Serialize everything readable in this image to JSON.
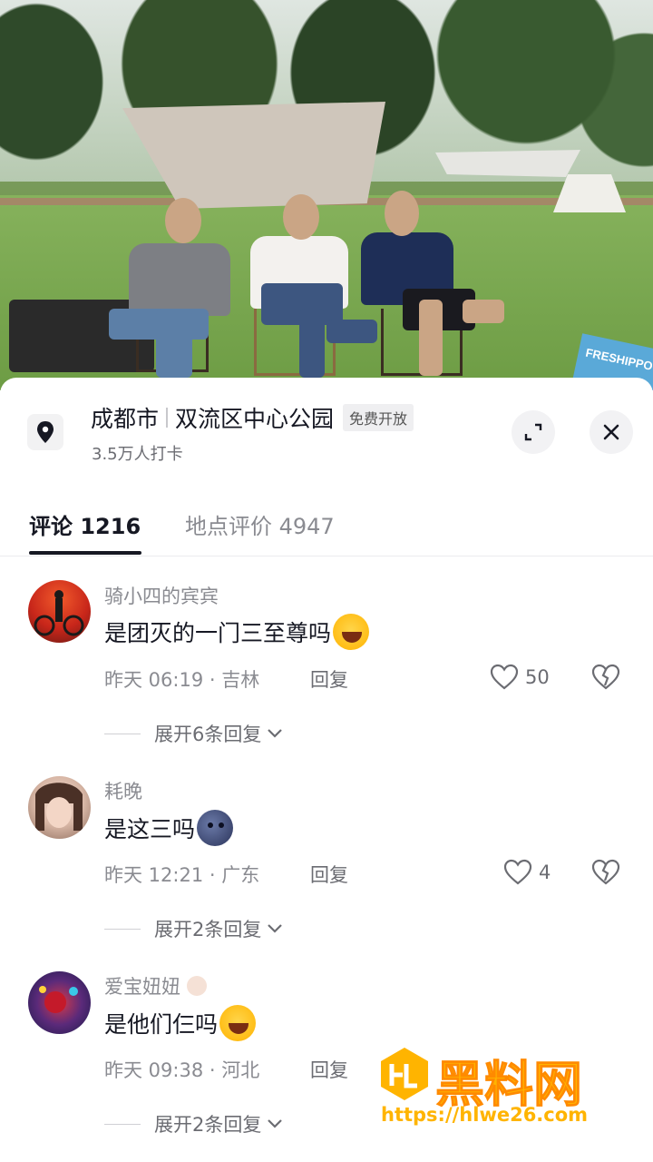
{
  "location": {
    "city": "成都市",
    "place": "双流区中心公园",
    "badge": "免费开放",
    "checkins": "3.5万人打卡"
  },
  "tabs": [
    {
      "label": "评论 1216",
      "active": true
    },
    {
      "label": "地点评价 4947",
      "active": false
    }
  ],
  "comments": [
    {
      "user": "骑小四的宾宾",
      "text": "是团灭的一门三至尊吗",
      "emoji": "grinning-squinting-face-tears",
      "time": "昨天 06:19",
      "region": "吉林",
      "reply": "回复",
      "likes": "50",
      "expand": "展开6条回复"
    },
    {
      "user": "耗晚",
      "text": "是这三吗",
      "emoji": "new-moon-face",
      "time": "昨天 12:21",
      "region": "广东",
      "reply": "回复",
      "likes": "4",
      "expand": "展开2条回复"
    },
    {
      "user": "爱宝妞妞",
      "text": "是他们仨吗",
      "emoji": "grinning-squinting-face-tears",
      "time": "昨天 09:38",
      "region": "河北",
      "reply": "回复",
      "likes": "",
      "expand": "展开2条回复"
    }
  ],
  "meta_separator": "·",
  "watermark": {
    "title": "黑料网",
    "url": "https://hlwe26.com"
  },
  "photo": {
    "sign_text": "FRESHIPPO"
  },
  "colors": {
    "primary_text": "#161823",
    "secondary_text": "#8a8b91",
    "watermark": "#ffb400"
  }
}
